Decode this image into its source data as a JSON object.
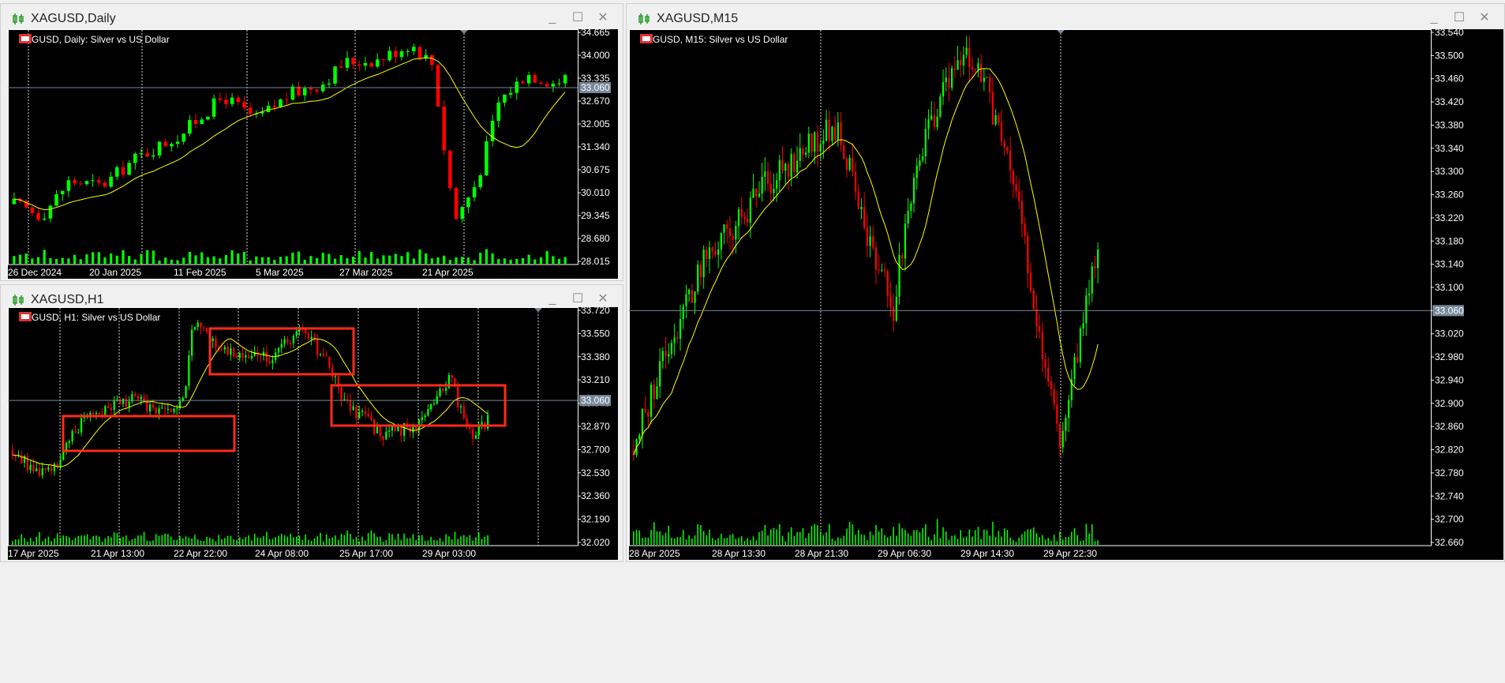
{
  "windows": [
    {
      "id": "daily",
      "title": "XAGUSD,Daily",
      "label": "XAGUSD, Daily:  Silver vs US Dollar",
      "price_labels": [
        "34.665",
        "34.000",
        "33.335",
        "32.670",
        "32.005",
        "31.340",
        "30.675",
        "30.010",
        "29.345",
        "28.680",
        "28.015"
      ],
      "price_min": 28.015,
      "price_max": 34.665,
      "current_price": "33.060",
      "date_labels": [
        "26 Dec 2024",
        "20 Jan 2025",
        "11 Feb 2025",
        "5 Mar 2025",
        "27 Mar 2025",
        "21 Apr 2025"
      ]
    },
    {
      "id": "h1",
      "title": "XAGUSD,H1",
      "label": "XAGUSD, H1:  Silver vs US Dollar",
      "price_labels": [
        "33.720",
        "33.550",
        "33.380",
        "33.210",
        "33.040",
        "32.870",
        "32.700",
        "32.530",
        "32.360",
        "32.190",
        "32.020"
      ],
      "price_min": 32.02,
      "price_max": 33.72,
      "current_price": "33.060",
      "date_labels": [
        "17 Apr 2025",
        "21 Apr 13:00",
        "22 Apr 22:00",
        "24 Apr 08:00",
        "25 Apr 17:00",
        "29 Apr 03:00"
      ]
    },
    {
      "id": "m15",
      "title": "XAGUSD,M15",
      "label": "XAGUSD, M15:  Silver vs US Dollar",
      "price_labels": [
        "33.540",
        "33.500",
        "33.460",
        "33.420",
        "33.380",
        "33.340",
        "33.300",
        "33.260",
        "33.220",
        "33.180",
        "33.140",
        "33.100",
        "33.060",
        "33.020",
        "32.980",
        "32.940",
        "32.900",
        "32.860",
        "32.820",
        "32.780",
        "32.740",
        "32.700",
        "32.660"
      ],
      "price_min": 32.66,
      "price_max": 33.54,
      "current_price": "33.060",
      "date_labels": [
        "28 Apr 2025",
        "28 Apr 13:30",
        "28 Apr 21:30",
        "29 Apr 06:30",
        "29 Apr 14:30",
        "29 Apr 22:30"
      ]
    }
  ],
  "colors": {
    "bull": "#00ff00",
    "bear": "#ff0000",
    "ma": "#ffff00",
    "grid": "#ffffff",
    "current_line": "#778899",
    "highlight_box": "#ff2a1a"
  },
  "icons": {
    "window": "candlestick-icon",
    "chart_label": "flag-icon"
  }
}
